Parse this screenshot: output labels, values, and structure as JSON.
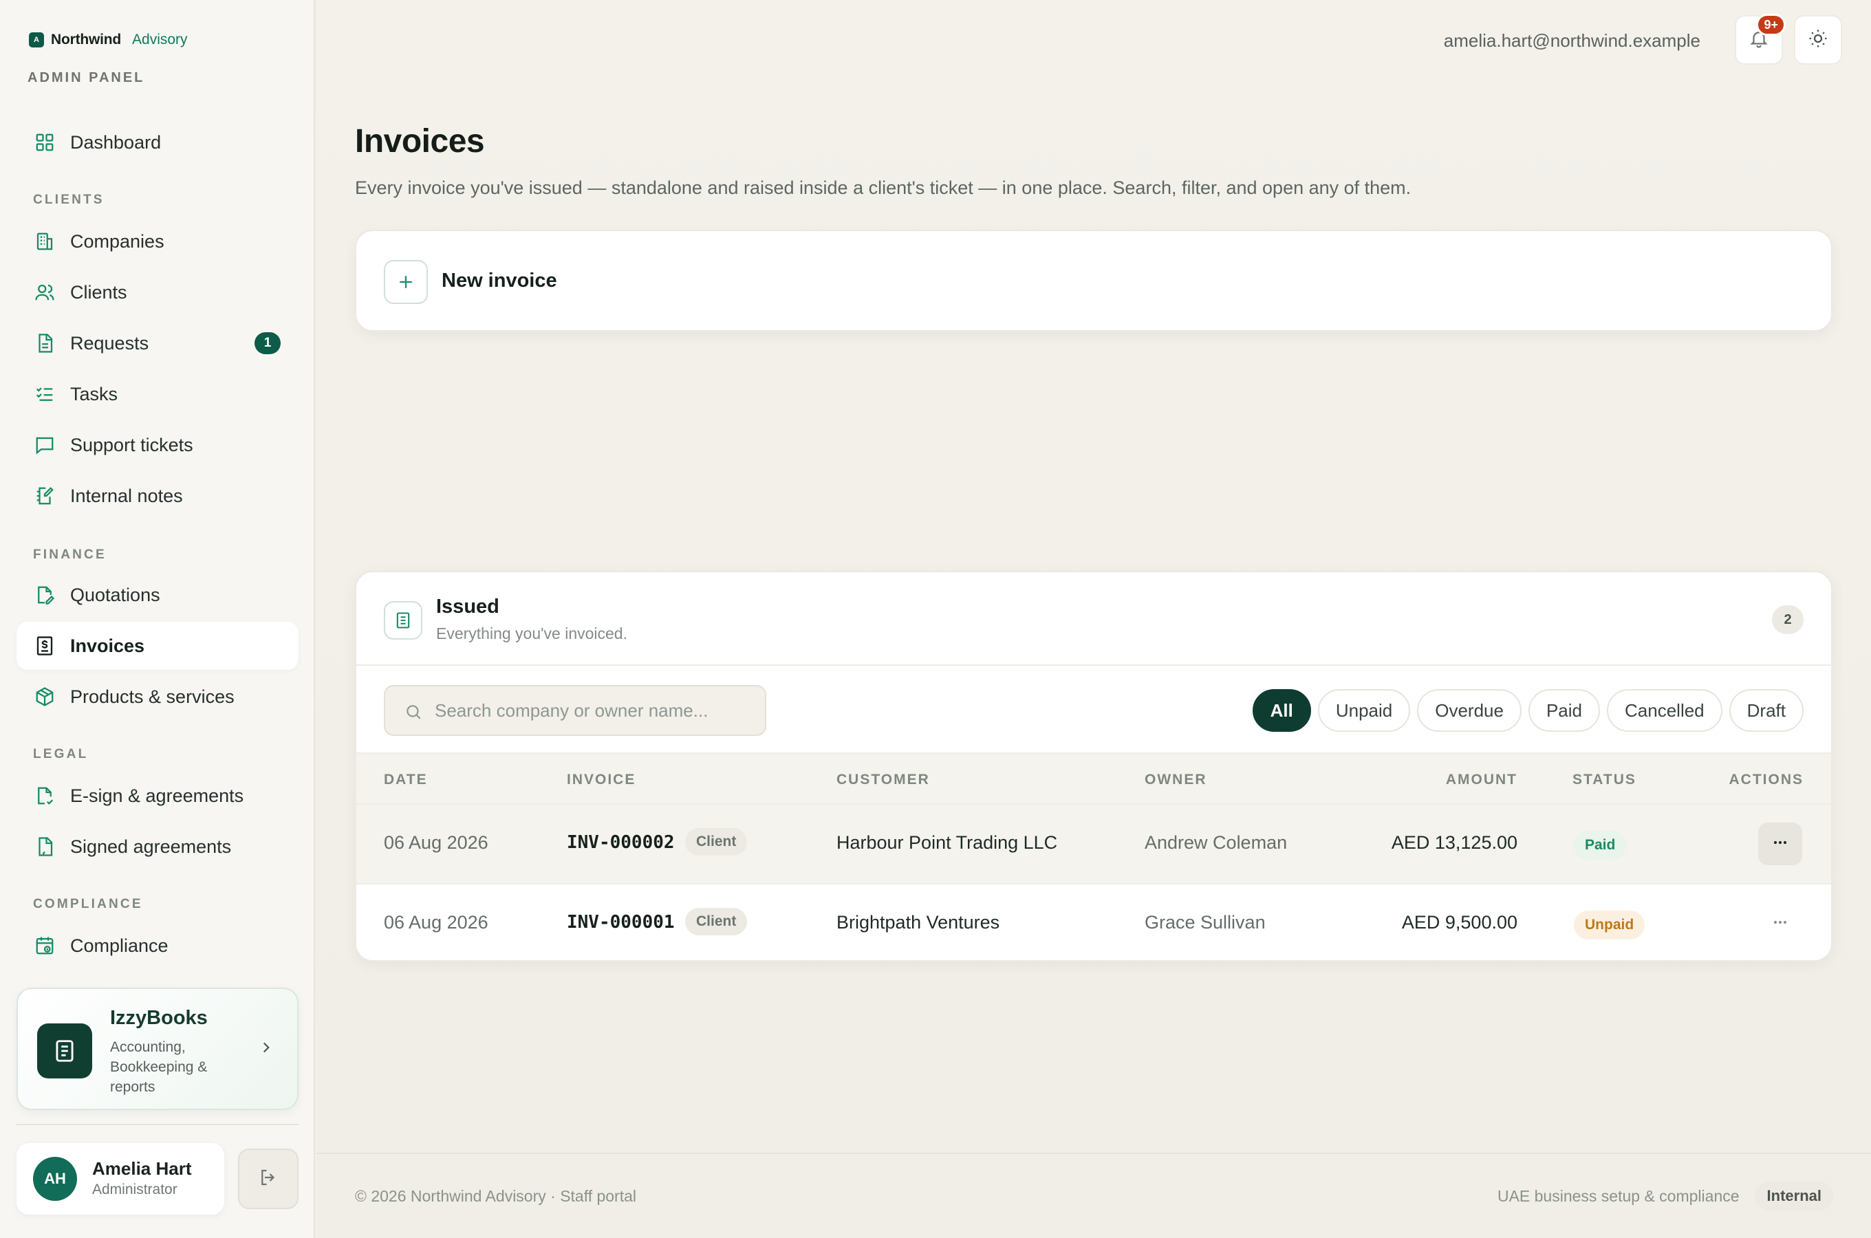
{
  "brand": {
    "name": "Northwind",
    "sub": "Advisory",
    "logo_letter": "A",
    "panel": "ADMIN PANEL"
  },
  "nav": {
    "dashboard": "Dashboard",
    "sections": {
      "clients": "CLIENTS",
      "finance": "FINANCE",
      "legal": "LEGAL",
      "compliance": "COMPLIANCE"
    },
    "companies": "Companies",
    "clients": "Clients",
    "requests": "Requests",
    "requests_badge": "1",
    "tasks": "Tasks",
    "support": "Support tickets",
    "notes": "Internal notes",
    "quotations": "Quotations",
    "invoices": "Invoices",
    "products": "Products & services",
    "esign": "E-sign & agreements",
    "signed": "Signed agreements",
    "compliance": "Compliance"
  },
  "promo": {
    "title": "IzzyBooks",
    "desc": "Accounting, Bookkeeping & reports"
  },
  "user": {
    "initials": "AH",
    "name": "Amelia Hart",
    "role": "Administrator"
  },
  "topbar": {
    "email": "amelia.hart@northwind.example",
    "notif_count": "9+"
  },
  "page": {
    "title": "Invoices",
    "subtitle": "Every invoice you've issued — standalone and raised inside a client's ticket — in one place. Search, filter, and open any of them."
  },
  "new_invoice": {
    "label": "New invoice"
  },
  "issued": {
    "title": "Issued",
    "subtitle": "Everything you've invoiced.",
    "count": "2",
    "search_placeholder": "Search company or owner name...",
    "filters": [
      "All",
      "Unpaid",
      "Overdue",
      "Paid",
      "Cancelled",
      "Draft"
    ],
    "active_filter": "All",
    "columns": {
      "date": "DATE",
      "invoice": "INVOICE",
      "customer": "CUSTOMER",
      "owner": "OWNER",
      "amount": "AMOUNT",
      "status": "STATUS",
      "actions": "ACTIONS"
    },
    "rows": [
      {
        "date": "06 Aug 2026",
        "invoice": "INV-000002",
        "tag": "Client",
        "customer": "Harbour Point Trading LLC",
        "owner": "Andrew Coleman",
        "amount": "AED 13,125.00",
        "status": "Paid"
      },
      {
        "date": "06 Aug 2026",
        "invoice": "INV-000001",
        "tag": "Client",
        "customer": "Brightpath Ventures",
        "owner": "Grace Sullivan",
        "amount": "AED 9,500.00",
        "status": "Unpaid"
      }
    ]
  },
  "footer": {
    "left": "© 2026 Northwind Advisory · Staff portal",
    "right_text": "UAE business setup & compliance",
    "right_pill": "Internal"
  },
  "colors": {
    "accent": "#0e5a48",
    "badge_red": "#c63b16",
    "paid": "#1d8a5b",
    "unpaid": "#c07818"
  }
}
